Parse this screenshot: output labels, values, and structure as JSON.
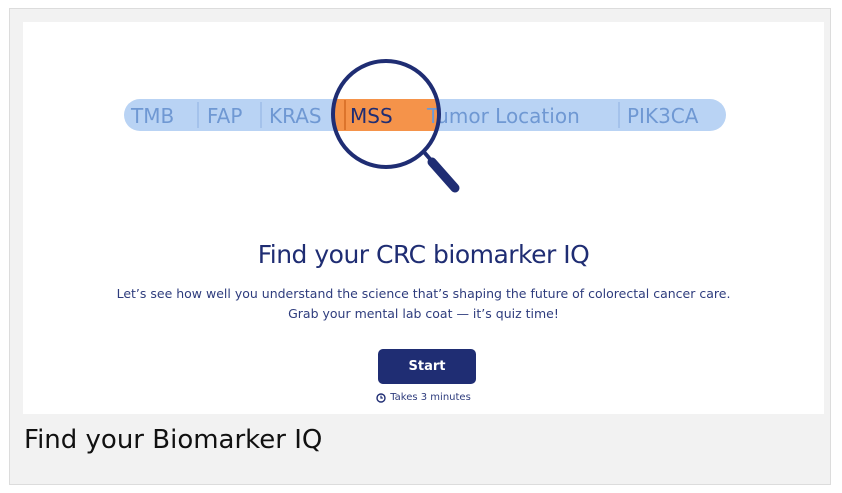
{
  "pill": {
    "labels": [
      "TMB",
      "FAP",
      "KRAS",
      "MSS",
      "Tumor Location",
      "PIK3CA"
    ]
  },
  "colors": {
    "pill_bg": "#b9d3f4",
    "pill_text": "#6f98d3",
    "highlight": "#f5934a",
    "navy": "#1f2d73"
  },
  "hero": {
    "title": "Find your CRC biomarker IQ",
    "subtitle_line1": "Let’s see how well you understand the science that’s shaping the future of colorectal cancer care.",
    "subtitle_line2": "Grab your mental lab coat — it’s quiz time!",
    "start_label": "Start",
    "duration": "Takes 3 minutes",
    "duration_icon": "clock-icon"
  },
  "caption": "Find your Biomarker IQ"
}
